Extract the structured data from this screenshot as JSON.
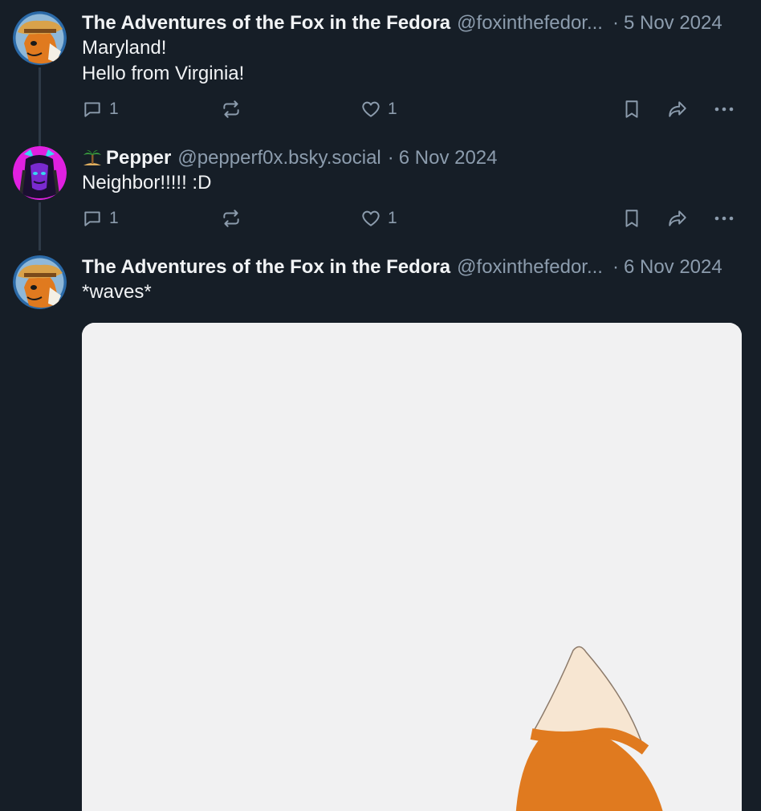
{
  "posts": [
    {
      "display_name": "The Adventures of the Fox in the Fedora",
      "handle": "@foxinthefedor...",
      "date": "5 Nov 2024",
      "body_lines": [
        "Maryland!",
        "Hello from Virginia!"
      ],
      "reply_count": "1",
      "repost_count": "",
      "like_count": "1"
    },
    {
      "display_name": "Pepper",
      "name_emoji": "palm-island-icon",
      "handle": "@pepperf0x.bsky.social",
      "date": "6 Nov 2024",
      "body_lines": [
        "Neighbor!!!!! :D"
      ],
      "reply_count": "1",
      "repost_count": "",
      "like_count": "1"
    },
    {
      "display_name": "The Adventures of the Fox in the Fedora",
      "handle": "@foxinthefedor...",
      "date": "6 Nov 2024",
      "body_lines": [
        "*waves*"
      ],
      "media": "fox-tail-image"
    }
  ],
  "separator": "·",
  "colors": {
    "background": "#161e27",
    "primary_text": "#f1f3f5",
    "secondary_text": "#8c9cad",
    "thread_line": "#2e3a47",
    "fox_orange": "#e07a1f"
  }
}
